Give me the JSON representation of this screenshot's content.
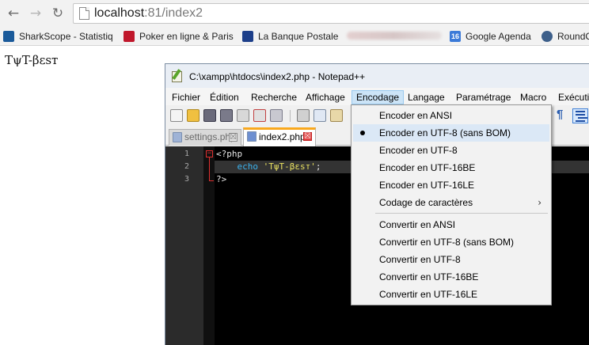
{
  "browser": {
    "nav": {
      "back": "←",
      "forward": "→",
      "reload": "↻"
    },
    "address": {
      "host": "localhost",
      "rest": ":81/index2"
    },
    "bookmarks": [
      {
        "label": "SharkScope - Statistiq",
        "icon": "sharkscope-icon",
        "color": "#1a5a9a"
      },
      {
        "label": "Poker en ligne & Paris",
        "icon": "winamax-icon",
        "color": "#c0172b"
      },
      {
        "label": "La Banque Postale",
        "icon": "banque-postale-icon",
        "color": "#1d3f8a"
      },
      {
        "label": "Google Agenda",
        "icon": "google-calendar-icon",
        "color": "#3b7ad8",
        "glyph": "16"
      },
      {
        "label": "RoundC",
        "icon": "roundcube-icon",
        "color": "#3d5f8a"
      }
    ]
  },
  "page": {
    "text": "TψT-βεsт"
  },
  "npp": {
    "title": "C:\\xampp\\htdocs\\index2.php - Notepad++",
    "menu": [
      "Fichier",
      "Édition",
      "Recherche",
      "Affichage",
      "Encodage",
      "Langage",
      "Paramétrage",
      "Macro",
      "Exécutio"
    ],
    "active_menu": "Encodage",
    "tabs": [
      {
        "label": "settings.php",
        "close": "☒"
      },
      {
        "label": "index2.php",
        "close": "☒"
      }
    ],
    "lines": [
      "1",
      "2",
      "3"
    ],
    "code": {
      "l1": "<?php",
      "l2_indent": "    ",
      "l2_echo": "echo",
      "l2_string": "'TψT-βεsт'",
      "l2_end": ";",
      "l3": "?>"
    },
    "toolbar_pilcrow": "¶"
  },
  "encoding_menu": {
    "group1": [
      "Encoder en ANSI",
      "Encoder en UTF-8 (sans BOM)",
      "Encoder en UTF-8",
      "Encoder en UTF-16BE",
      "Encoder en UTF-16LE",
      "Codage de caractères"
    ],
    "submenu_arrow": "›",
    "group2": [
      "Convertir en ANSI",
      "Convertir en UTF-8 (sans BOM)",
      "Convertir en UTF-8",
      "Convertir en UTF-16BE",
      "Convertir en UTF-16LE"
    ],
    "selected": "Encoder en UTF-8 (sans BOM)"
  }
}
